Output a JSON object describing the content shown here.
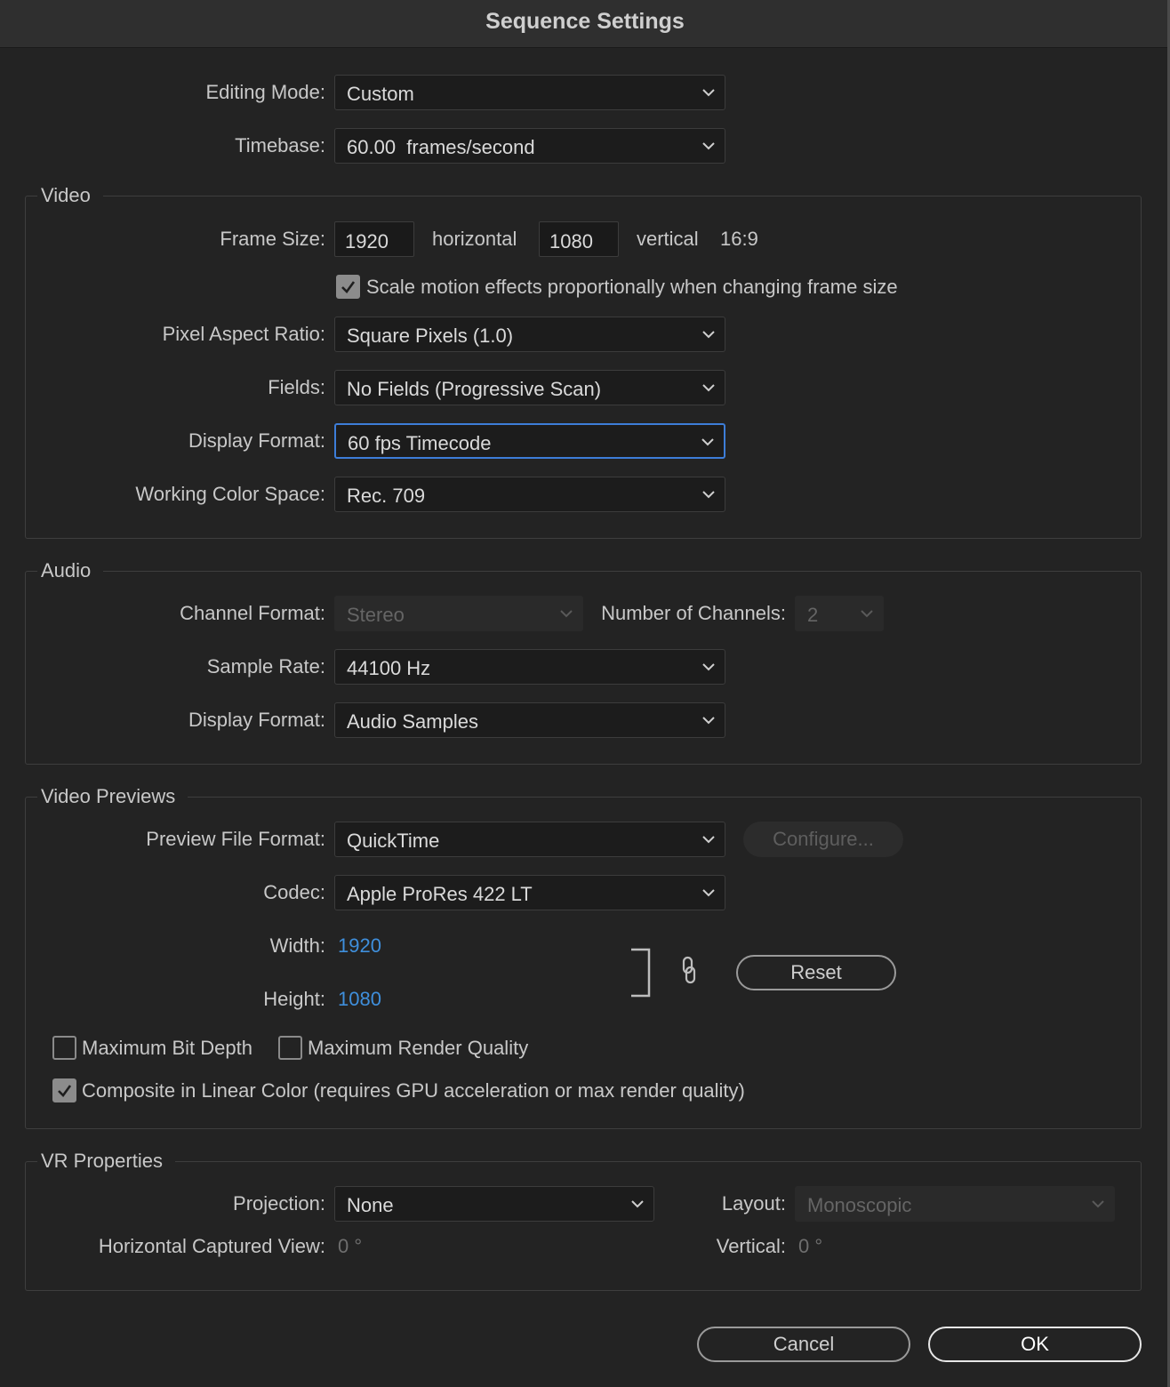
{
  "window": {
    "title": "Sequence Settings"
  },
  "general": {
    "editing_mode_label": "Editing Mode:",
    "editing_mode_value": "Custom",
    "timebase_label": "Timebase:",
    "timebase_value": "60.00  frames/second"
  },
  "video": {
    "legend": "Video",
    "frame_size_label": "Frame Size:",
    "frame_width": "1920",
    "horizontal_label": "horizontal",
    "frame_height": "1080",
    "vertical_label": "vertical",
    "aspect": "16:9",
    "scale_motion_label": "Scale motion effects proportionally when changing frame size",
    "scale_motion_checked": true,
    "pixel_aspect_label": "Pixel Aspect Ratio:",
    "pixel_aspect_value": "Square Pixels (1.0)",
    "fields_label": "Fields:",
    "fields_value": "No Fields (Progressive Scan)",
    "display_format_label": "Display Format:",
    "display_format_value": "60 fps Timecode",
    "color_space_label": "Working Color Space:",
    "color_space_value": "Rec. 709"
  },
  "audio": {
    "legend": "Audio",
    "channel_format_label": "Channel Format:",
    "channel_format_value": "Stereo",
    "num_channels_label": "Number of Channels:",
    "num_channels_value": "2",
    "sample_rate_label": "Sample Rate:",
    "sample_rate_value": "44100 Hz",
    "display_format_label": "Display Format:",
    "display_format_value": "Audio Samples"
  },
  "previews": {
    "legend": "Video Previews",
    "file_format_label": "Preview File Format:",
    "file_format_value": "QuickTime",
    "configure_label": "Configure...",
    "codec_label": "Codec:",
    "codec_value": "Apple ProRes 422 LT",
    "width_label": "Width:",
    "width_value": "1920",
    "height_label": "Height:",
    "height_value": "1080",
    "reset_label": "Reset",
    "max_bit_depth_label": "Maximum Bit Depth",
    "max_bit_depth_checked": false,
    "max_render_label": "Maximum Render Quality",
    "max_render_checked": false,
    "linear_color_label": "Composite in Linear Color (requires GPU acceleration or max render quality)",
    "linear_color_checked": true
  },
  "vr": {
    "legend": "VR Properties",
    "projection_label": "Projection:",
    "projection_value": "None",
    "layout_label": "Layout:",
    "layout_value": "Monoscopic",
    "horizontal_view_label": "Horizontal Captured View:",
    "horizontal_view_value": "0 °",
    "vertical_label": "Vertical:",
    "vertical_value": "0 °"
  },
  "footer": {
    "cancel_label": "Cancel",
    "ok_label": "OK"
  },
  "colors": {
    "accent": "#3d7dd8",
    "link_value": "#3f8fdc",
    "background": "#232323"
  }
}
